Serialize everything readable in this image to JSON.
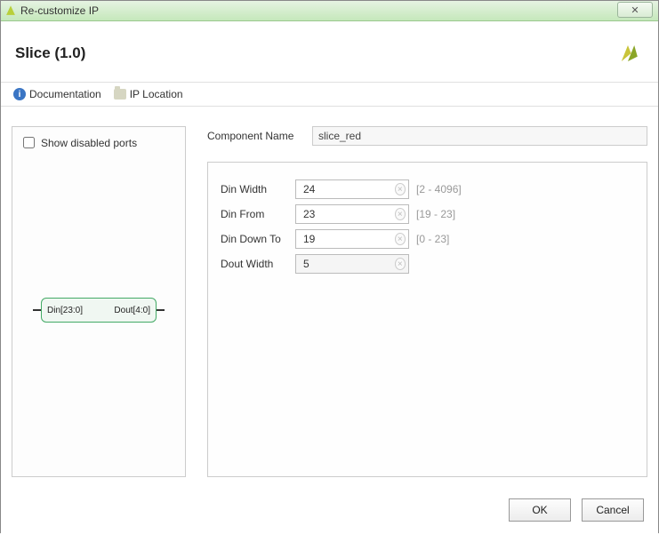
{
  "window": {
    "title": "Re-customize IP"
  },
  "header": {
    "title": "Slice (1.0)"
  },
  "toolbar": {
    "documentation": "Documentation",
    "ip_location": "IP Location"
  },
  "left": {
    "show_disabled_ports": "Show disabled ports",
    "port_in": "Din[23:0]",
    "port_out": "Dout[4:0]"
  },
  "component": {
    "label": "Component Name",
    "value": "slice_red"
  },
  "params": [
    {
      "label": "Din Width",
      "value": "24",
      "range": "[2 - 4096]",
      "readonly": false
    },
    {
      "label": "Din From",
      "value": "23",
      "range": "[19 - 23]",
      "readonly": false
    },
    {
      "label": "Din Down To",
      "value": "19",
      "range": "[0 - 23]",
      "readonly": false
    },
    {
      "label": "Dout Width",
      "value": "5",
      "range": "",
      "readonly": true
    }
  ],
  "buttons": {
    "ok": "OK",
    "cancel": "Cancel"
  }
}
